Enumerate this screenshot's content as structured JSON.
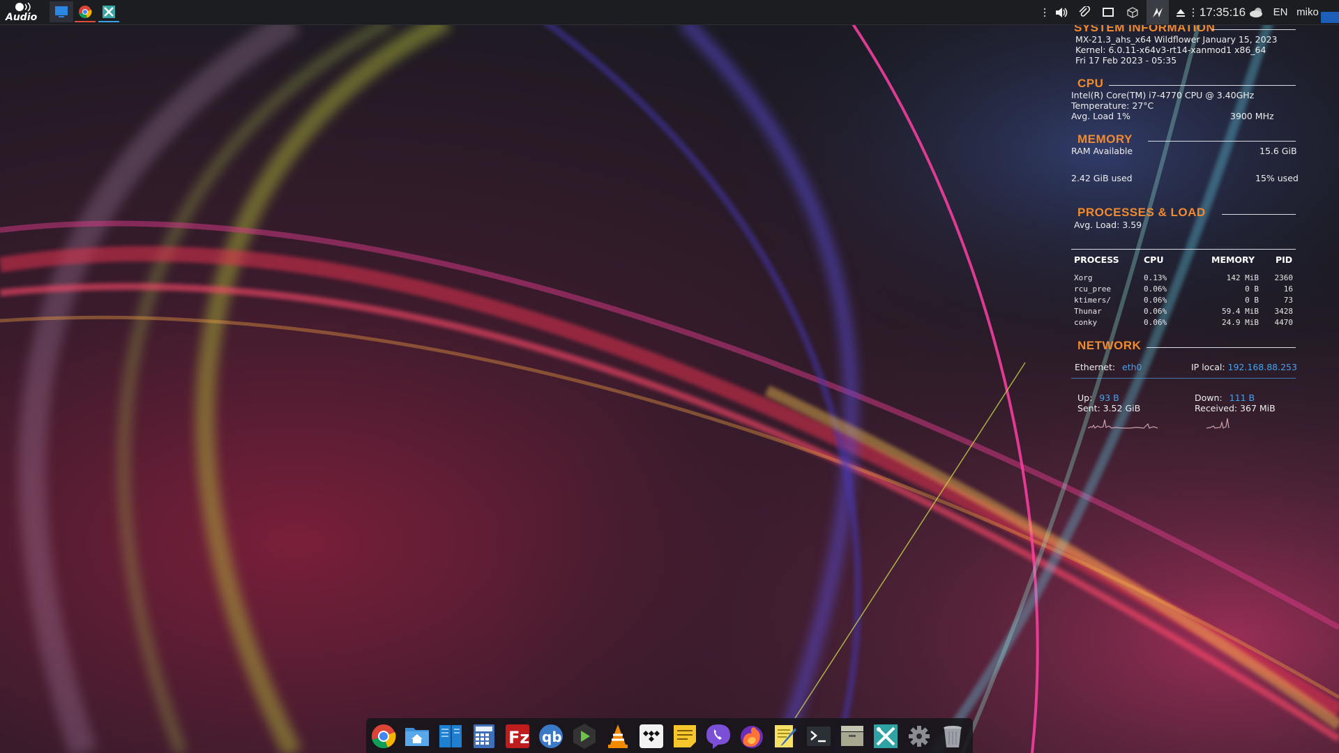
{
  "colors": {
    "accent_orange": "#f28a2e",
    "value_blue": "#4aa0e8",
    "panel_bg": "#1b1d21"
  },
  "top_panel": {
    "logo": {
      "icon": "diy-audio-logo",
      "text": "diy Audio"
    },
    "taskbar": [
      {
        "name": "desktop",
        "icon": "desktop-icon"
      },
      {
        "name": "chrome",
        "icon": "chrome-icon"
      },
      {
        "name": "mx-tools",
        "icon": "mx-tools-icon"
      }
    ],
    "tray": {
      "icons": [
        "volume-icon",
        "clipboard-icon",
        "display-icon",
        "package-icon",
        "updates-icon",
        "eject-icon",
        "weather-icon"
      ],
      "clock": "17:35:16",
      "language": "EN",
      "user": "miko"
    }
  },
  "conky": {
    "system": {
      "title": "SYSTEM INFORMATION",
      "distro": "MX-21.3_ahs_x64 Wildflower January 15, 2023",
      "kernel": "Kernel: 6.0.11-x64v3-rt14-xanmod1 x86_64",
      "date": "Fri 17 Feb 2023 - 05:35"
    },
    "cpu": {
      "title": "CPU",
      "model": "Intel(R) Core(TM) i7-4770 CPU @ 3.40GHz",
      "temperature": "Temperature:  27°C",
      "avg_load": "Avg. Load 1%",
      "freq": "3900 MHz"
    },
    "memory": {
      "title": "MEMORY",
      "ram_label": "RAM Available",
      "ram_value": "15.6 GiB",
      "used": "2.42 GiB used",
      "used_pct": "15% used"
    },
    "processes": {
      "title": "PROCESSES & LOAD",
      "avg_load": "Avg. Load: 3.59",
      "headers": [
        "PROCESS",
        "CPU",
        "MEMORY",
        "PID"
      ],
      "rows": [
        {
          "name": "Xorg",
          "cpu": "0.13%",
          "mem": "142 MiB",
          "pid": "2360"
        },
        {
          "name": "rcu_pree",
          "cpu": "0.06%",
          "mem": "0 B",
          "pid": "16"
        },
        {
          "name": "ktimers/",
          "cpu": "0.06%",
          "mem": "0 B",
          "pid": "73"
        },
        {
          "name": "Thunar",
          "cpu": "0.06%",
          "mem": "59.4 MiB",
          "pid": "3428"
        },
        {
          "name": "conky",
          "cpu": "0.06%",
          "mem": "24.9 MiB",
          "pid": "4470"
        }
      ]
    },
    "network": {
      "title": "NETWORK",
      "ethernet_label": "Ethernet:",
      "ethernet_iface": "eth0",
      "ip_label": "IP local:",
      "ip_value": "192.168.88.253",
      "up_label": "Up:",
      "up_value": "93 B",
      "down_label": "Down:",
      "down_value": "111 B",
      "sent": "Sent: 3.52 GiB",
      "received": "Received: 367 MiB"
    }
  },
  "dock": {
    "items": [
      {
        "name": "chrome",
        "icon": "chrome-icon"
      },
      {
        "name": "files",
        "icon": "home-folder-icon"
      },
      {
        "name": "book",
        "icon": "book-icon"
      },
      {
        "name": "calculator",
        "icon": "calculator-icon"
      },
      {
        "name": "filezilla",
        "icon": "filezilla-icon"
      },
      {
        "name": "qbittorrent",
        "icon": "qbittorrent-icon"
      },
      {
        "name": "media-player",
        "icon": "play-icon"
      },
      {
        "name": "vlc",
        "icon": "vlc-icon"
      },
      {
        "name": "tidal",
        "icon": "tidal-icon"
      },
      {
        "name": "notes",
        "icon": "notes-icon"
      },
      {
        "name": "viber",
        "icon": "viber-icon"
      },
      {
        "name": "firefox",
        "icon": "firefox-icon"
      },
      {
        "name": "text-editor",
        "icon": "text-editor-icon"
      },
      {
        "name": "terminal",
        "icon": "terminal-icon"
      },
      {
        "name": "archive-manager",
        "icon": "archive-icon"
      },
      {
        "name": "mx-tools",
        "icon": "mx-tools-icon"
      },
      {
        "name": "settings",
        "icon": "gear-icon"
      },
      {
        "name": "trash",
        "icon": "trash-icon"
      }
    ]
  }
}
